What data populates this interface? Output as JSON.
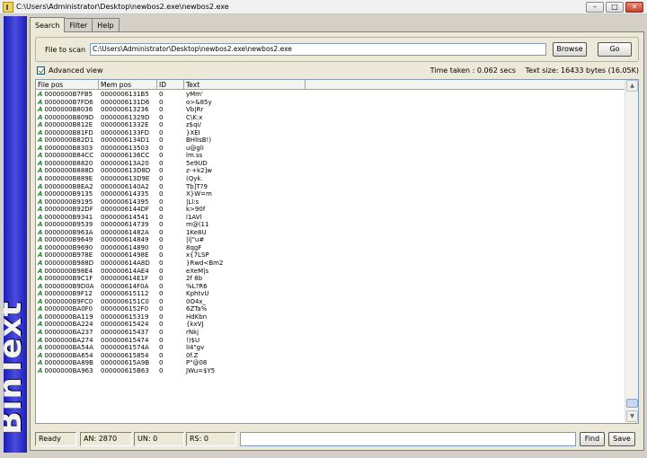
{
  "window": {
    "title": "C:\\Users\\Administrator\\Desktop\\newbos2.exe\\newbos2.exe"
  },
  "sidebar": {
    "logo_text": "BinText"
  },
  "tabs": [
    {
      "label": "Search"
    },
    {
      "label": "Filter"
    },
    {
      "label": "Help"
    }
  ],
  "scan": {
    "label": "File to scan",
    "value": "C:\\Users\\Administrator\\Desktop\\newbos2.exe\\newbos2.exe",
    "browse_label": "Browse",
    "go_label": "Go"
  },
  "options": {
    "advanced_view_label": "Advanced view",
    "advanced_view_checked": true
  },
  "stats": {
    "time_taken": "Time taken : 0.062 secs",
    "text_size": "Text size: 16433 bytes (16.05K)"
  },
  "columns": [
    "File pos",
    "Mem pos",
    "ID",
    "Text"
  ],
  "rows": [
    {
      "type": "A",
      "file_pos": "0000000B7FB5",
      "mem_pos": "0000006131B5",
      "id": "0",
      "text": "yMm'"
    },
    {
      "type": "A",
      "file_pos": "0000000B7FD6",
      "mem_pos": "0000006131D6",
      "id": "0",
      "text": "o>&85y"
    },
    {
      "type": "A",
      "file_pos": "0000000B8036",
      "mem_pos": "000000613236",
      "id": "0",
      "text": "Vb|Rr"
    },
    {
      "type": "A",
      "file_pos": "0000000B809D",
      "mem_pos": "00000061329D",
      "id": "0",
      "text": "C\\K:x"
    },
    {
      "type": "A",
      "file_pos": "0000000B812E",
      "mem_pos": "00000061332E",
      "id": "0",
      "text": "z$qi/"
    },
    {
      "type": "A",
      "file_pos": "0000000B81FD",
      "mem_pos": "0000006133FD",
      "id": "0",
      "text": "}XEI"
    },
    {
      "type": "A",
      "file_pos": "0000000B82D1",
      "mem_pos": "0000006134D1",
      "id": "0",
      "text": "BHlIsB!)"
    },
    {
      "type": "A",
      "file_pos": "0000000B8303",
      "mem_pos": "000000613503",
      "id": "0",
      "text": "u@gli"
    },
    {
      "type": "A",
      "file_pos": "0000000B84CC",
      "mem_pos": "0000006136CC",
      "id": "0",
      "text": "lm.ss"
    },
    {
      "type": "A",
      "file_pos": "0000000B8820",
      "mem_pos": "000000613A20",
      "id": "0",
      "text": "5e9UD"
    },
    {
      "type": "A",
      "file_pos": "0000000B888D",
      "mem_pos": "000000613D8D",
      "id": "0",
      "text": "z-+k2]w"
    },
    {
      "type": "A",
      "file_pos": "0000000B889E",
      "mem_pos": "000000613D9E",
      "id": "0",
      "text": "(Qyk."
    },
    {
      "type": "A",
      "file_pos": "0000000B8EA2",
      "mem_pos": "0000006140A2",
      "id": "0",
      "text": "Tb]T?9"
    },
    {
      "type": "A",
      "file_pos": "0000000B9135",
      "mem_pos": "000000614335",
      "id": "0",
      "text": "X}W=m"
    },
    {
      "type": "A",
      "file_pos": "0000000B9195",
      "mem_pos": "000000614395",
      "id": "0",
      "text": "|Ll:s"
    },
    {
      "type": "A",
      "file_pos": "0000000B92DF",
      "mem_pos": "0000006144DF",
      "id": "0",
      "text": "k>90f"
    },
    {
      "type": "A",
      "file_pos": "0000000B9341",
      "mem_pos": "000000614541",
      "id": "0",
      "text": "l1AVl"
    },
    {
      "type": "A",
      "file_pos": "0000000B9539",
      "mem_pos": "000000614739",
      "id": "0",
      "text": "m@(11"
    },
    {
      "type": "A",
      "file_pos": "0000000B963A",
      "mem_pos": "00000061482A",
      "id": "0",
      "text": "1Ke8U"
    },
    {
      "type": "A",
      "file_pos": "0000000B9649",
      "mem_pos": "000000614849",
      "id": "0",
      "text": "|i|\"u#"
    },
    {
      "type": "A",
      "file_pos": "0000000B9690",
      "mem_pos": "000000614890",
      "id": "0",
      "text": "8qgF"
    },
    {
      "type": "A",
      "file_pos": "0000000B978E",
      "mem_pos": "00000061498E",
      "id": "0",
      "text": "x{7LSP"
    },
    {
      "type": "A",
      "file_pos": "0000000B988D",
      "mem_pos": "000000614A8D",
      "id": "0",
      "text": "}Rwd<Bm2"
    },
    {
      "type": "A",
      "file_pos": "0000000B98E4",
      "mem_pos": "000000614AE4",
      "id": "0",
      "text": "eXeM|s"
    },
    {
      "type": "A",
      "file_pos": "0000000B9C1F",
      "mem_pos": "000000614E1F",
      "id": "0",
      "text": "2f 8b"
    },
    {
      "type": "A",
      "file_pos": "0000000B9D0A",
      "mem_pos": "000000614F0A",
      "id": "0",
      "text": "%L?R6"
    },
    {
      "type": "A",
      "file_pos": "0000000B9F12",
      "mem_pos": "000000615112",
      "id": "0",
      "text": "KphtvU"
    },
    {
      "type": "A",
      "file_pos": "0000000B9FC0",
      "mem_pos": "0000006151C0",
      "id": "0",
      "text": "0O4x_"
    },
    {
      "type": "A",
      "file_pos": "0000000BA0F0",
      "mem_pos": "0000006152F0",
      "id": "0",
      "text": "6ZTa%"
    },
    {
      "type": "A",
      "file_pos": "0000000BA119",
      "mem_pos": "000000615319",
      "id": "0",
      "text": "HdKbn"
    },
    {
      "type": "A",
      "file_pos": "0000000BA224",
      "mem_pos": "000000615424",
      "id": "0",
      "text": "{kxVJ"
    },
    {
      "type": "A",
      "file_pos": "0000000BA237",
      "mem_pos": "000000615437",
      "id": "0",
      "text": "rNkj"
    },
    {
      "type": "A",
      "file_pos": "0000000BA274",
      "mem_pos": "000000615474",
      "id": "0",
      "text": "!)$U"
    },
    {
      "type": "A",
      "file_pos": "0000000BA54A",
      "mem_pos": "00000061574A",
      "id": "0",
      "text": "lI4\"gv"
    },
    {
      "type": "A",
      "file_pos": "0000000BA654",
      "mem_pos": "000000615854",
      "id": "0",
      "text": "0f.Z"
    },
    {
      "type": "A",
      "file_pos": "0000000BA89B",
      "mem_pos": "000000615A9B",
      "id": "0",
      "text": "P\"@08"
    },
    {
      "type": "A",
      "file_pos": "0000000BA963",
      "mem_pos": "000000615B63",
      "id": "0",
      "text": "JWu=$Y5"
    }
  ],
  "status": {
    "ready": "Ready",
    "an": "AN: 2870",
    "un": "UN: 0",
    "rs": "RS: 0",
    "find_label": "Find",
    "save_label": "Save"
  }
}
